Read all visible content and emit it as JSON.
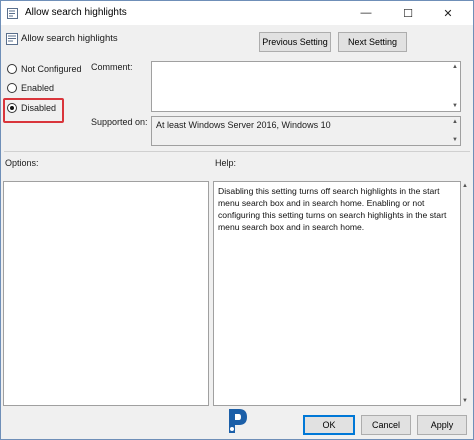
{
  "window": {
    "title": "Allow search highlights",
    "controls": {
      "minimize": "—",
      "maximize": "☐",
      "close": "✕"
    }
  },
  "header": {
    "setting_name": "Allow search highlights",
    "previous_label": "Previous Setting",
    "next_label": "Next Setting"
  },
  "state": {
    "options": [
      {
        "label": "Not Configured",
        "checked": false
      },
      {
        "label": "Enabled",
        "checked": false
      },
      {
        "label": "Disabled",
        "checked": true
      }
    ],
    "highlight_color": "#d9353b"
  },
  "fields": {
    "comment_label": "Comment:",
    "comment_value": "",
    "supported_label": "Supported on:",
    "supported_value": "At least Windows Server 2016, Windows 10"
  },
  "panels": {
    "options_label": "Options:",
    "help_label": "Help:",
    "help_text": "Disabling this setting turns off search highlights in the start menu search box and in search home. Enabling or not configuring this setting turns on search highlights in the start menu search box and in search home."
  },
  "footer": {
    "ok_label": "OK",
    "cancel_label": "Cancel",
    "apply_label": "Apply"
  },
  "icons": {
    "app": "policy-setting-icon",
    "header": "policy-setting-icon",
    "logo": "watermark-logo-icon"
  },
  "colors": {
    "window_bg": "#f0f0f0",
    "accent": "#0078d7",
    "logo_blue": "#1b5fa8"
  }
}
